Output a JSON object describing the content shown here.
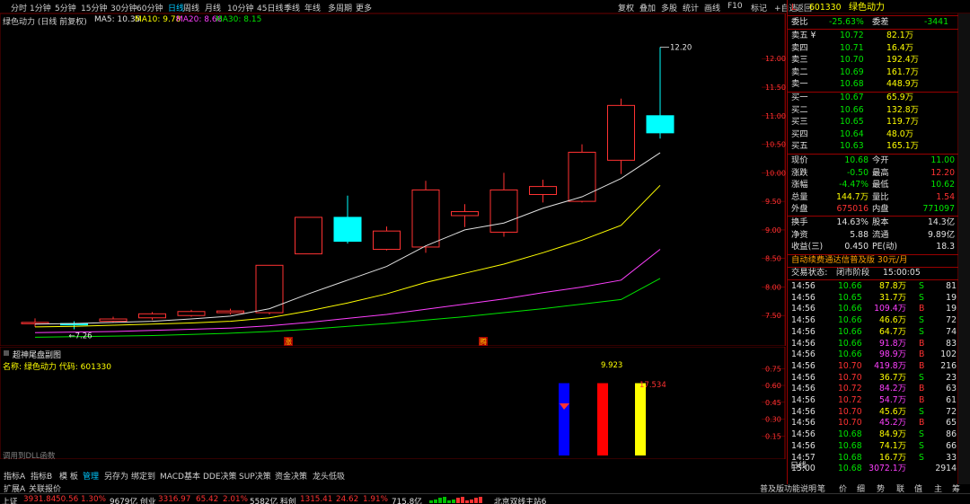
{
  "top_tabs": [
    "分时",
    "1分钟",
    "5分钟",
    "15分钟",
    "30分钟",
    "60分钟",
    "日线",
    "周线",
    "月线",
    "10分钟",
    "45日线",
    "季线",
    "年线",
    "多周期",
    "更多"
  ],
  "active_tab": "日线",
  "top_right_buttons": [
    "复权",
    "叠加",
    "多股",
    "统计",
    "画线",
    "F10",
    "标记",
    "+自选",
    "返回"
  ],
  "chart": {
    "title": "绿色动力 (日线 前复权)",
    "ma5": "MA5: 10.35",
    "ma10": "MA10: 9.78",
    "ma20": "MA20: 8.66",
    "ma30": "MA30: 8.15",
    "high_label": "12.20",
    "low_label": "7.26",
    "markers": [
      "涨",
      "腾"
    ],
    "y_ticks": [
      "12.00",
      "11.50",
      "11.00",
      "10.50",
      "10.00",
      "9.50",
      "9.00",
      "8.50",
      "8.00",
      "7.50"
    ]
  },
  "candles": [
    {
      "o": 7.36,
      "c": 7.38,
      "h": 7.45,
      "l": 7.3
    },
    {
      "o": 7.36,
      "c": 7.34,
      "h": 7.4,
      "l": 7.26
    },
    {
      "o": 7.4,
      "c": 7.44,
      "h": 7.48,
      "l": 7.38
    },
    {
      "o": 7.46,
      "c": 7.53,
      "h": 7.56,
      "l": 7.42
    },
    {
      "o": 7.5,
      "c": 7.57,
      "h": 7.6,
      "l": 7.48
    },
    {
      "o": 7.55,
      "c": 7.58,
      "h": 7.62,
      "l": 7.52
    },
    {
      "o": 7.55,
      "c": 8.38,
      "h": 8.38,
      "l": 7.52
    },
    {
      "o": 8.58,
      "c": 9.22,
      "h": 9.22,
      "l": 8.58
    },
    {
      "o": 9.22,
      "c": 8.8,
      "h": 9.6,
      "l": 8.76
    },
    {
      "o": 8.66,
      "c": 8.98,
      "h": 9.06,
      "l": 8.64
    },
    {
      "o": 8.7,
      "c": 9.7,
      "h": 9.86,
      "l": 8.6
    },
    {
      "o": 9.25,
      "c": 9.32,
      "h": 9.45,
      "l": 9.05
    },
    {
      "o": 8.96,
      "c": 9.7,
      "h": 10.0,
      "l": 8.88
    },
    {
      "o": 9.62,
      "c": 9.76,
      "h": 9.88,
      "l": 9.48
    },
    {
      "o": 9.5,
      "c": 10.36,
      "h": 10.5,
      "l": 9.48
    },
    {
      "o": 10.22,
      "c": 11.18,
      "h": 11.3,
      "l": 9.98
    },
    {
      "o": 11.0,
      "c": 10.7,
      "h": 12.2,
      "l": 10.6
    }
  ],
  "ma_lines": {
    "ma5": [
      7.35,
      7.36,
      7.38,
      7.4,
      7.44,
      7.49,
      7.62,
      7.88,
      8.12,
      8.36,
      8.72,
      9.0,
      9.12,
      9.38,
      9.58,
      9.9,
      10.35
    ],
    "ma10": [
      7.3,
      7.31,
      7.33,
      7.35,
      7.37,
      7.4,
      7.46,
      7.58,
      7.72,
      7.88,
      8.08,
      8.24,
      8.4,
      8.6,
      8.82,
      9.08,
      9.78
    ],
    "ma20": [
      7.2,
      7.21,
      7.22,
      7.24,
      7.26,
      7.28,
      7.32,
      7.38,
      7.45,
      7.52,
      7.61,
      7.7,
      7.79,
      7.9,
      8.0,
      8.12,
      8.66
    ],
    "ma30": [
      7.12,
      7.13,
      7.14,
      7.15,
      7.17,
      7.19,
      7.22,
      7.26,
      7.31,
      7.36,
      7.42,
      7.48,
      7.55,
      7.62,
      7.7,
      7.78,
      8.15
    ]
  },
  "indicator": {
    "title": "超神尾盘副图",
    "info": "名称: 绿色动力 代码: 601330",
    "value_a": "9.923",
    "value_b": "17.534",
    "note": "调用到DLL函数",
    "y_ticks": [
      "0.75",
      "0.60",
      "0.45",
      "0.30",
      "0.15"
    ],
    "bars": [
      {
        "value": 0.62,
        "color": "#0000ff"
      },
      {
        "value": 0.62,
        "color": "#ff0000"
      },
      {
        "value": 0.62,
        "color": "#ffff00"
      }
    ]
  },
  "bottom_tabs": [
    "指标A",
    "指标B",
    "模 板",
    "管理",
    "另存为",
    "绑定到",
    "MACD基本",
    "DDE决策",
    "SUP决策",
    "资金决策",
    "龙头低吸"
  ],
  "active_bottom_tab": "管理",
  "bottom_tabs2": [
    "扩展A",
    "关联报价"
  ],
  "right_label_axis": "日线",
  "quote": {
    "code": "601330",
    "name": "绿色动力",
    "side_letter": "L",
    "weibi_label": "委比",
    "weibi": "-25.63%",
    "weicha_label": "委差",
    "weicha": "-3441",
    "asks": [
      {
        "label": "卖五 ¥",
        "price": "10.72",
        "vol": "82.1万"
      },
      {
        "label": "卖四",
        "price": "10.71",
        "vol": "16.4万"
      },
      {
        "label": "卖三",
        "price": "10.70",
        "vol": "192.4万"
      },
      {
        "label": "卖二",
        "price": "10.69",
        "vol": "161.7万"
      },
      {
        "label": "卖一",
        "price": "10.68",
        "vol": "448.9万"
      }
    ],
    "bids": [
      {
        "label": "买一",
        "price": "10.67",
        "vol": "65.9万"
      },
      {
        "label": "买二",
        "price": "10.66",
        "vol": "132.8万"
      },
      {
        "label": "买三",
        "price": "10.65",
        "vol": "119.7万"
      },
      {
        "label": "买四",
        "price": "10.64",
        "vol": "48.0万"
      },
      {
        "label": "买五",
        "price": "10.63",
        "vol": "165.1万"
      }
    ],
    "stats": [
      {
        "l1": "现价",
        "v1": "10.68",
        "l2": "今开",
        "v2": "11.00"
      },
      {
        "l1": "涨跌",
        "v1": "-0.50",
        "l2": "最高",
        "v2": "12.20"
      },
      {
        "l1": "涨幅",
        "v1": "-4.47%",
        "l2": "最低",
        "v2": "10.62"
      },
      {
        "l1": "总量",
        "v1": "144.7万",
        "l2": "量比",
        "v2": "1.54"
      },
      {
        "l1": "外盘",
        "v1": "675016",
        "l2": "内盘",
        "v2": "771097"
      }
    ],
    "fund": [
      {
        "l1": "换手",
        "v1": "14.63%",
        "l2": "股本",
        "v2": "14.3亿"
      },
      {
        "l1": "净资",
        "v1": "5.88",
        "l2": "流通",
        "v2": "9.89亿"
      },
      {
        "l1": "收益(三)",
        "v1": "0.450",
        "l2": "PE(动)",
        "v2": "18.3"
      }
    ],
    "promo": "自动续费通达信普及版 30元/月",
    "trade_state_label": "交易状态:",
    "trade_state": "闭市阶段",
    "trade_time": "15:00:05"
  },
  "ticks": [
    {
      "t": "14:56",
      "p": "10.66",
      "v": "87.8万",
      "d": "S",
      "n": "81"
    },
    {
      "t": "14:56",
      "p": "10.65",
      "v": "31.7万",
      "d": "S",
      "n": "19"
    },
    {
      "t": "14:56",
      "p": "10.66",
      "v": "109.4万",
      "d": "B",
      "n": "19"
    },
    {
      "t": "14:56",
      "p": "10.66",
      "v": "46.6万",
      "d": "S",
      "n": "72"
    },
    {
      "t": "14:56",
      "p": "10.66",
      "v": "64.7万",
      "d": "S",
      "n": "74"
    },
    {
      "t": "14:56",
      "p": "10.66",
      "v": "91.8万",
      "d": "B",
      "n": "83"
    },
    {
      "t": "14:56",
      "p": "10.66",
      "v": "98.9万",
      "d": "B",
      "n": "102"
    },
    {
      "t": "14:56",
      "p": "10.70",
      "v": "419.8万",
      "d": "B",
      "n": "216"
    },
    {
      "t": "14:56",
      "p": "10.70",
      "v": "36.7万",
      "d": "S",
      "n": "23"
    },
    {
      "t": "14:56",
      "p": "10.72",
      "v": "84.2万",
      "d": "B",
      "n": "63"
    },
    {
      "t": "14:56",
      "p": "10.72",
      "v": "54.7万",
      "d": "B",
      "n": "61"
    },
    {
      "t": "14:56",
      "p": "10.70",
      "v": "45.6万",
      "d": "S",
      "n": "72"
    },
    {
      "t": "14:56",
      "p": "10.70",
      "v": "45.2万",
      "d": "B",
      "n": "65"
    },
    {
      "t": "14:56",
      "p": "10.68",
      "v": "84.9万",
      "d": "S",
      "n": "86"
    },
    {
      "t": "14:56",
      "p": "10.68",
      "v": "74.1万",
      "d": "S",
      "n": "66"
    },
    {
      "t": "14:57",
      "p": "10.68",
      "v": "16.7万",
      "d": "S",
      "n": "33"
    },
    {
      "t": "15:00",
      "p": "10.68",
      "v": "3072.1万",
      "d": "",
      "n": "2914"
    }
  ],
  "right_bottom_buttons": [
    "普及版功能说明",
    "笔",
    "价",
    "细",
    "势",
    "联",
    "值",
    "主",
    "筹"
  ],
  "status": {
    "idx1_name": "上证",
    "idx1_val": "3931.84",
    "idx1_chg": "50.56",
    "idx1_pct": "1.30%",
    "idx1_amt": "9679亿",
    "idx2_name": "创业",
    "idx2_val": "3316.97",
    "idx2_chg": "65.42",
    "idx2_pct": "2.01%",
    "idx2_amt": "5582亿",
    "idx3_name": "科创",
    "idx3_val": "1315.41",
    "idx3_chg": "24.62",
    "idx3_pct": "1.91%",
    "idx3_amt": "715.8亿",
    "server": "北京双线主站6"
  }
}
